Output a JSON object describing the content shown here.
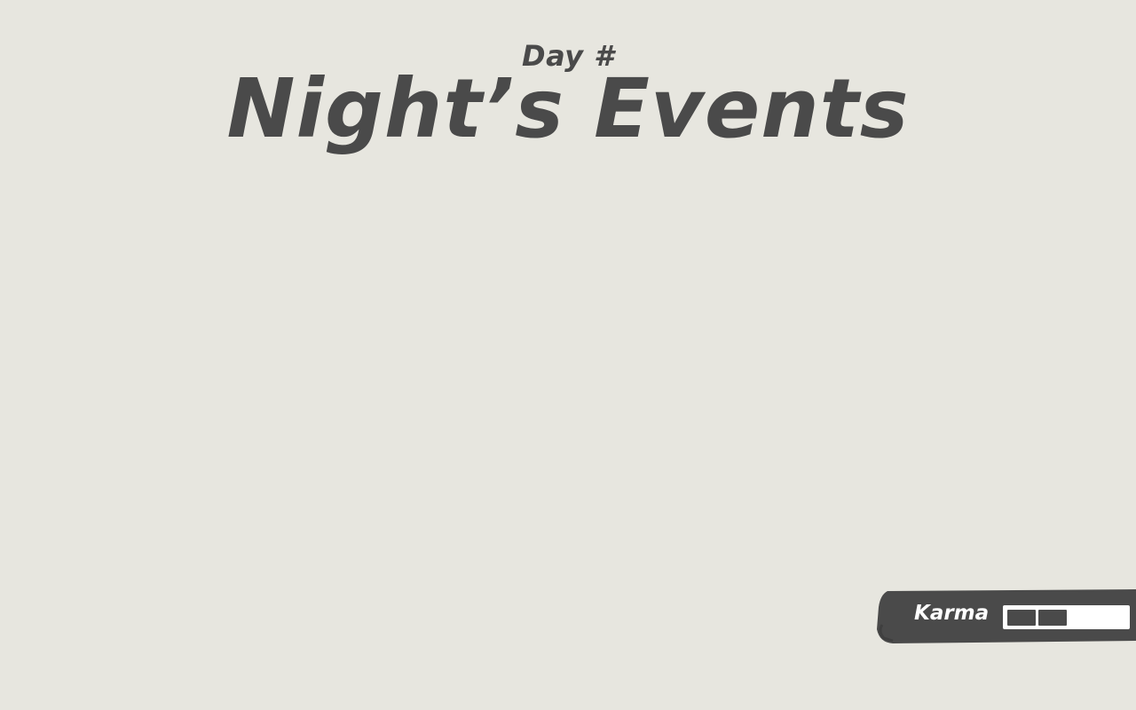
{
  "header": {
    "day_label": "Day #",
    "title": "Night’s Events"
  },
  "karma": {
    "label": "Karma",
    "filled": 2,
    "total": 4
  },
  "colors": {
    "background": "#e7e6df",
    "ink": "#4a4a4a",
    "panel": "#4a4a4a",
    "panel_text": "#ffffff"
  }
}
